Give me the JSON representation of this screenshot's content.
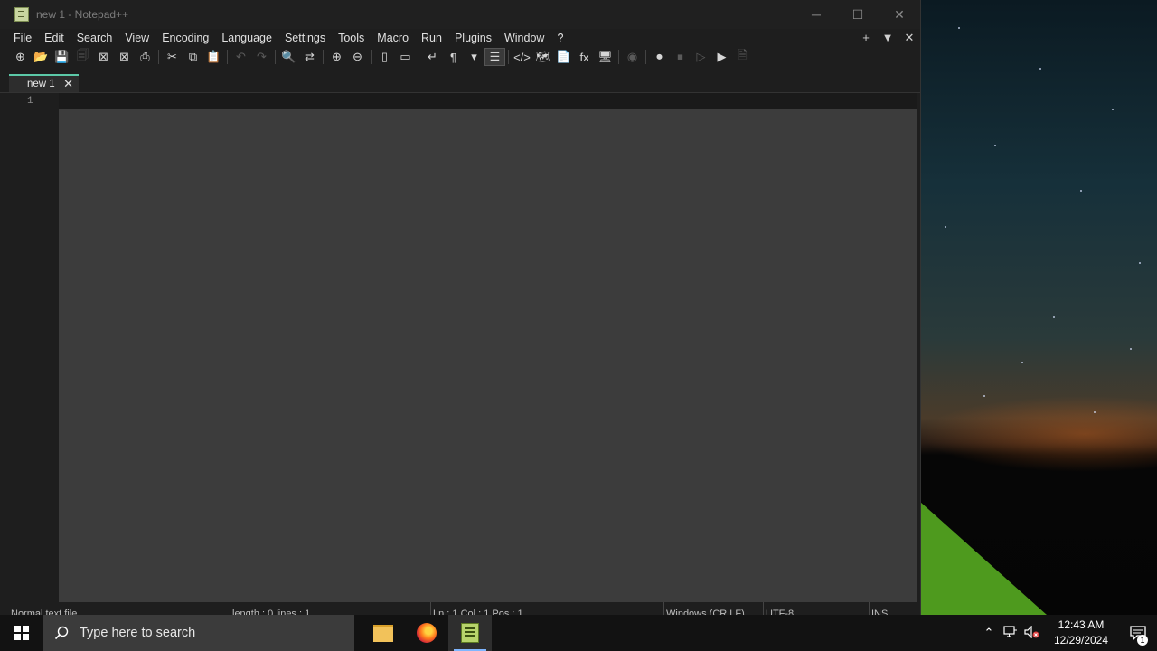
{
  "window": {
    "title": "new 1 - Notepad++",
    "controls": {
      "minimize": "─",
      "maximize": "☐",
      "close": "✕"
    }
  },
  "menu": {
    "items": [
      "File",
      "Edit",
      "Search",
      "View",
      "Encoding",
      "Language",
      "Settings",
      "Tools",
      "Macro",
      "Run",
      "Plugins",
      "Window",
      "?"
    ],
    "right": {
      "add": "+",
      "dropdown": "▼",
      "close": "✕"
    }
  },
  "toolbar": {
    "buttons": [
      {
        "name": "new-file-icon",
        "glyph": "⊕",
        "enabled": true
      },
      {
        "name": "open-file-icon",
        "glyph": "📂",
        "enabled": true
      },
      {
        "name": "save-icon",
        "glyph": "💾",
        "enabled": false
      },
      {
        "name": "save-all-icon",
        "glyph": "🗐",
        "enabled": false
      },
      {
        "name": "close-file-icon",
        "glyph": "⊠",
        "enabled": true
      },
      {
        "name": "close-all-icon",
        "glyph": "⊠",
        "enabled": true
      },
      {
        "name": "print-icon",
        "glyph": "⎙",
        "enabled": true
      },
      {
        "sep": true
      },
      {
        "name": "cut-icon",
        "glyph": "✂",
        "enabled": true
      },
      {
        "name": "copy-icon",
        "glyph": "⧉",
        "enabled": true
      },
      {
        "name": "paste-icon",
        "glyph": "📋",
        "enabled": false
      },
      {
        "sep": true
      },
      {
        "name": "undo-icon",
        "glyph": "↶",
        "enabled": false
      },
      {
        "name": "redo-icon",
        "glyph": "↷",
        "enabled": false
      },
      {
        "sep": true
      },
      {
        "name": "find-icon",
        "glyph": "🔍",
        "enabled": true
      },
      {
        "name": "replace-icon",
        "glyph": "⇄",
        "enabled": true
      },
      {
        "sep": true
      },
      {
        "name": "zoom-in-icon",
        "glyph": "⊕",
        "enabled": true
      },
      {
        "name": "zoom-out-icon",
        "glyph": "⊖",
        "enabled": true
      },
      {
        "sep": true
      },
      {
        "name": "sync-vertical-icon",
        "glyph": "▯",
        "enabled": true
      },
      {
        "name": "sync-horizontal-icon",
        "glyph": "▭",
        "enabled": true
      },
      {
        "sep": true
      },
      {
        "name": "word-wrap-icon",
        "glyph": "↵",
        "enabled": true
      },
      {
        "name": "show-all-chars-icon",
        "glyph": "¶",
        "enabled": true
      },
      {
        "name": "dropdown-arrow-icon",
        "glyph": "▾",
        "enabled": true
      },
      {
        "name": "indent-guide-icon",
        "glyph": "☰",
        "enabled": true,
        "active": true
      },
      {
        "sep": true
      },
      {
        "name": "code-icon",
        "glyph": "</>",
        "enabled": true
      },
      {
        "name": "document-map-icon",
        "glyph": "🗺",
        "enabled": true
      },
      {
        "name": "document-list-icon",
        "glyph": "📄",
        "enabled": true
      },
      {
        "name": "function-list-icon",
        "glyph": "fx",
        "enabled": true
      },
      {
        "name": "folder-workspace-icon",
        "glyph": "🖥",
        "enabled": true
      },
      {
        "sep": true
      },
      {
        "name": "monitoring-icon",
        "glyph": "◉",
        "enabled": false
      },
      {
        "sep": true
      },
      {
        "name": "record-macro-icon",
        "glyph": "⏺",
        "enabled": true
      },
      {
        "name": "stop-macro-icon",
        "glyph": "⏹",
        "enabled": false
      },
      {
        "name": "play-macro-icon",
        "glyph": "▷",
        "enabled": false
      },
      {
        "name": "run-macro-multiple-icon",
        "glyph": "▶",
        "enabled": true
      },
      {
        "name": "save-macro-icon",
        "glyph": "🗎",
        "enabled": false
      }
    ]
  },
  "tabs": [
    {
      "label": "new 1",
      "close": "✕"
    }
  ],
  "editor": {
    "line_numbers": [
      "1"
    ]
  },
  "statusbar": [
    "Normal text file",
    "length : 0    lines : 1",
    "Ln : 1    Col : 1    Pos : 1",
    "Windows (CR LF)",
    "UTF-8",
    "INS"
  ],
  "taskbar": {
    "search_placeholder": "Type here to search",
    "clock_time": "12:43 AM",
    "clock_date": "12/29/2024",
    "notification_count": "1"
  }
}
